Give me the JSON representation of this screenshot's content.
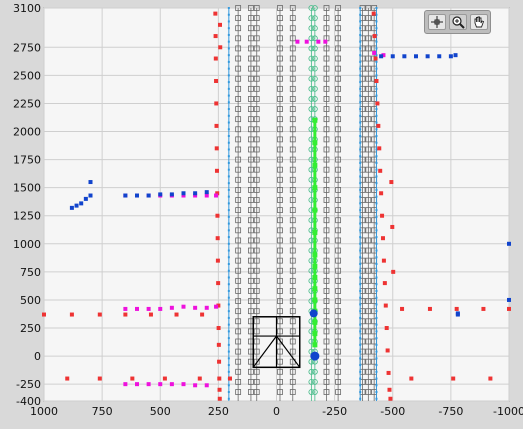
{
  "graph_palette": {
    "tools": [
      {
        "name": "cursor-move-tool",
        "icon": "crosshair-icon"
      },
      {
        "name": "zoom-tool",
        "icon": "magnifier-icon"
      },
      {
        "name": "pan-tool",
        "icon": "hand-icon"
      }
    ]
  },
  "chart_data": {
    "type": "scatter",
    "title": "",
    "xlabel": "",
    "ylabel": "",
    "xlim": [
      1000,
      -1000
    ],
    "ylim": [
      -400,
      3100
    ],
    "x_reversed": true,
    "grid": true,
    "x_ticks": [
      "1000",
      "750",
      "500",
      "250",
      "0",
      "-250",
      "-500",
      "-750",
      "-1000"
    ],
    "y_ticks": [
      "3100",
      "2750",
      "2500",
      "2250",
      "2000",
      "1750",
      "1500",
      "1250",
      "1000",
      "750",
      "500",
      "250",
      "0",
      "-250",
      "-400"
    ],
    "colors": {
      "red": "#ee3333",
      "magenta": "#ee11dd",
      "blue": "#1144cc",
      "cyan_line": "#3399dd",
      "green": "#33ee33",
      "gray_box": "#6a6a6a",
      "vehicle": "#000000"
    },
    "series": [
      {
        "name": "red-points",
        "color": "#ee3333",
        "x": [
          263,
          262,
          261,
          260,
          259,
          258,
          257,
          256,
          255,
          254,
          253,
          252,
          251,
          250,
          249,
          248,
          247,
          246,
          245,
          244,
          243,
          242,
          -418,
          -422,
          -426,
          -430,
          -434,
          -438,
          -442,
          -446,
          -450,
          -454,
          -458,
          -462,
          -466,
          -470,
          -474,
          -478,
          -482,
          -486,
          -490,
          -494,
          -498,
          -502,
          1000,
          880,
          760,
          650,
          540,
          430,
          320,
          -540,
          -660,
          -775,
          -890,
          -1000,
          900,
          760,
          620,
          480,
          330,
          200,
          -580,
          -760,
          -920
        ],
        "y": [
          3050,
          2850,
          2650,
          2450,
          2250,
          2050,
          1850,
          1650,
          1450,
          1250,
          1050,
          850,
          650,
          450,
          250,
          100,
          -50,
          -200,
          -300,
          -380,
          2950,
          2750,
          3050,
          2850,
          2650,
          2450,
          2250,
          2050,
          1850,
          1650,
          1450,
          1250,
          1050,
          850,
          650,
          450,
          250,
          50,
          -150,
          -300,
          -380,
          1550,
          1150,
          750,
          370,
          370,
          370,
          370,
          370,
          370,
          370,
          420,
          420,
          420,
          420,
          420,
          -200,
          -200,
          -200,
          -200,
          -200,
          -200,
          -200,
          -200,
          -200
        ]
      },
      {
        "name": "magenta-points",
        "color": "#ee11dd",
        "x": [
          650,
          600,
          550,
          500,
          450,
          400,
          350,
          300,
          260,
          650,
          600,
          550,
          500,
          450,
          400,
          350,
          300,
          260,
          650,
          600,
          550,
          500,
          450,
          400,
          350,
          300,
          -90,
          -130,
          -180,
          -210,
          -420,
          -460
        ],
        "y": [
          1430,
          1430,
          1430,
          1430,
          1430,
          1430,
          1430,
          1430,
          1430,
          420,
          420,
          420,
          420,
          430,
          440,
          430,
          430,
          440,
          -250,
          -250,
          -250,
          -250,
          -250,
          -250,
          -260,
          -260,
          2800,
          2800,
          2800,
          2800,
          2700,
          2680
        ],
        "note": ""
      },
      {
        "name": "blue-points",
        "color": "#1144cc",
        "x": [
          880,
          860,
          840,
          820,
          800,
          800,
          650,
          600,
          550,
          500,
          450,
          400,
          350,
          300,
          -450,
          -500,
          -550,
          -600,
          -650,
          -700,
          -750,
          -770,
          -780,
          -780,
          -1000,
          -1000
        ],
        "y": [
          1320,
          1340,
          1360,
          1400,
          1430,
          1550,
          1430,
          1430,
          1430,
          1440,
          1440,
          1450,
          1450,
          1460,
          2670,
          2670,
          2670,
          2670,
          2670,
          2670,
          2670,
          2680,
          380,
          370,
          1000,
          500
        ]
      },
      {
        "name": "green-points",
        "color": "#33ee33",
        "x": [
          -165,
          -165,
          -165,
          -165,
          -165,
          -165,
          -165,
          -165,
          -165,
          -165,
          -165,
          -165,
          -165,
          -165,
          -165
        ],
        "y": [
          2100,
          1900,
          1700,
          1500,
          1300,
          1100,
          900,
          800,
          700,
          600,
          500,
          400,
          300,
          200,
          100
        ]
      }
    ],
    "lane_lines": {
      "gray_box_x": [
        165,
        110,
        85,
        -15,
        -70,
        -215,
        -265,
        -370,
        -395,
        -420
      ],
      "cyan_x": [
        205,
        -360,
        -430
      ],
      "green_circle_x": [
        -165,
        -150
      ]
    },
    "vehicle": {
      "x_range": [
        100,
        -100
      ],
      "y_range": [
        -100,
        350
      ]
    }
  }
}
